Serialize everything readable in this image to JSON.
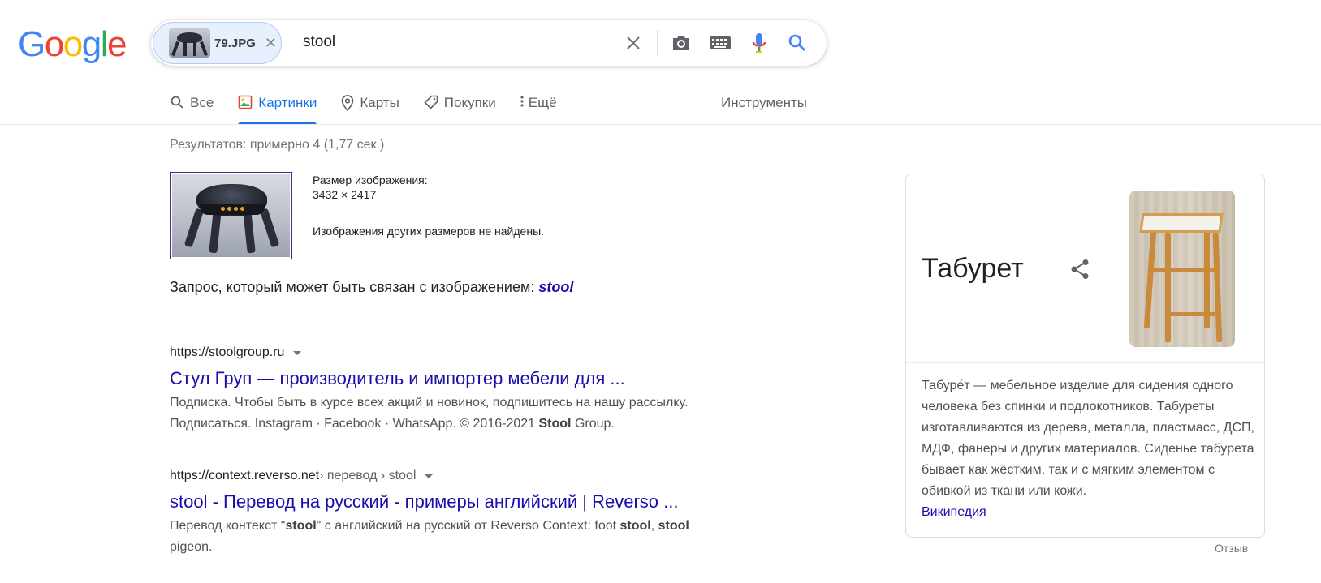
{
  "logo": {
    "letters": [
      "G",
      "o",
      "o",
      "g",
      "l",
      "e"
    ],
    "colors": [
      "#4285F4",
      "#EA4335",
      "#FBBC05",
      "#4285F4",
      "#34A853",
      "#EA4335"
    ]
  },
  "search": {
    "chip_filename": "79.JPG",
    "query": "stool",
    "icons": [
      "close-icon",
      "camera-icon",
      "keyboard-icon",
      "mic-icon",
      "search-icon"
    ]
  },
  "tabs": [
    {
      "label": "Все",
      "icon": "search-icon",
      "active": false
    },
    {
      "label": "Картинки",
      "icon": "image-icon",
      "active": true
    },
    {
      "label": "Карты",
      "icon": "map-pin-icon",
      "active": false
    },
    {
      "label": "Покупки",
      "icon": "tag-icon",
      "active": false
    },
    {
      "label": "Ещё",
      "icon": "more-vert-icon",
      "active": false
    }
  ],
  "tools_label": "Инструменты",
  "stats": "Результатов: примерно 4 (1,77 сек.)",
  "image_info": {
    "size_label": "Размер изображения:",
    "size_value": "3432 × 2417",
    "no_other_sizes": "Изображения других размеров не найдены."
  },
  "related": {
    "prefix": "Запрос, который может быть связан с изображением:",
    "term": "stool"
  },
  "results": [
    {
      "url": "https://stoolgroup.ru",
      "path": "",
      "title": "Стул Груп — производитель и импортер мебели для ...",
      "snippet_line1": "Подписка. Чтобы быть в курсе всех акций и новинок, подпишитесь на нашу рассылку.",
      "snippet_line2_pre": "Подписаться. Instagram · Facebook · WhatsApp. © 2016-2021 ",
      "snippet_line2_bold": "Stool",
      "snippet_line2_post": " Group."
    },
    {
      "url": "https://context.reverso.net",
      "path": " › перевод › stool",
      "title": "stool - Перевод на русский - примеры английский | Reverso ...",
      "snippet_pre": "Перевод контекст \"",
      "snippet_b1": "stool",
      "snippet_mid": "\" с английский на русский от Reverso Context: foot ",
      "snippet_b2": "stool",
      "snippet_sep": ", ",
      "snippet_b3": "stool",
      "snippet_line2": "pigeon."
    }
  ],
  "knowledge_panel": {
    "title": "Табурет",
    "description": "Табуре́т — мебельное изделие для сидения одного человека без спинки и подлокотников. Табуреты изготавливаются из дерева, металла, пластмасс, ДСП, МДФ, фанеры и других материалов. Сиденье табурета бывает как жёстким, так и с мягким элементом с обивкой из ткани или кожи.",
    "source": "Википедия"
  },
  "feedback": "Отзыв"
}
